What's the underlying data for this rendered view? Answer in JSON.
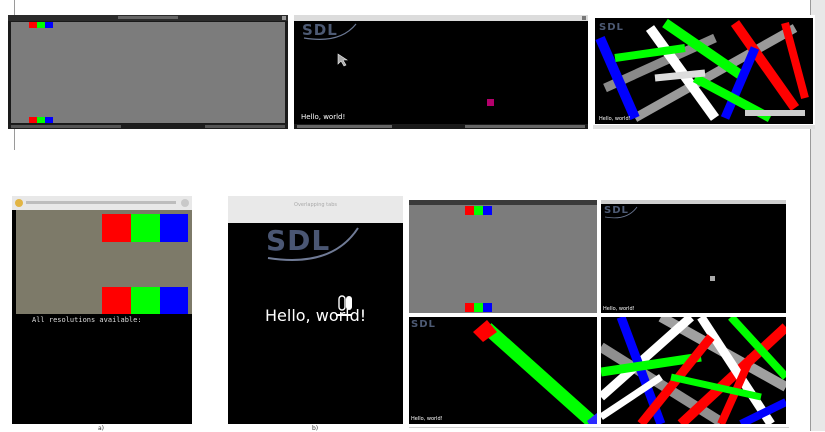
{
  "top_row": {
    "shot1": {
      "title": ""
    },
    "shot2": {
      "logo": "SDL",
      "hello": "Hello, world!"
    },
    "shot3": {
      "logo": "SDL",
      "hello": "Hello, world!"
    }
  },
  "bottom_row": {
    "shot_a": {
      "text": "All resolutions available:",
      "caption": "a)"
    },
    "shot_b": {
      "header": "Overlapping tabs",
      "logo": "SDL",
      "hello": "Hello, world!",
      "caption": "b)"
    },
    "grid": {
      "tr": {
        "logo": "SDL",
        "hello": "Hello, world!"
      },
      "bl": {
        "logo": "SDL",
        "hello": "Hello, world!"
      }
    }
  },
  "colors": {
    "red": "#ff0000",
    "green": "#00ff00",
    "blue": "#0000ff",
    "gray": "#7c7c7c",
    "olive": "#7d7a69"
  }
}
